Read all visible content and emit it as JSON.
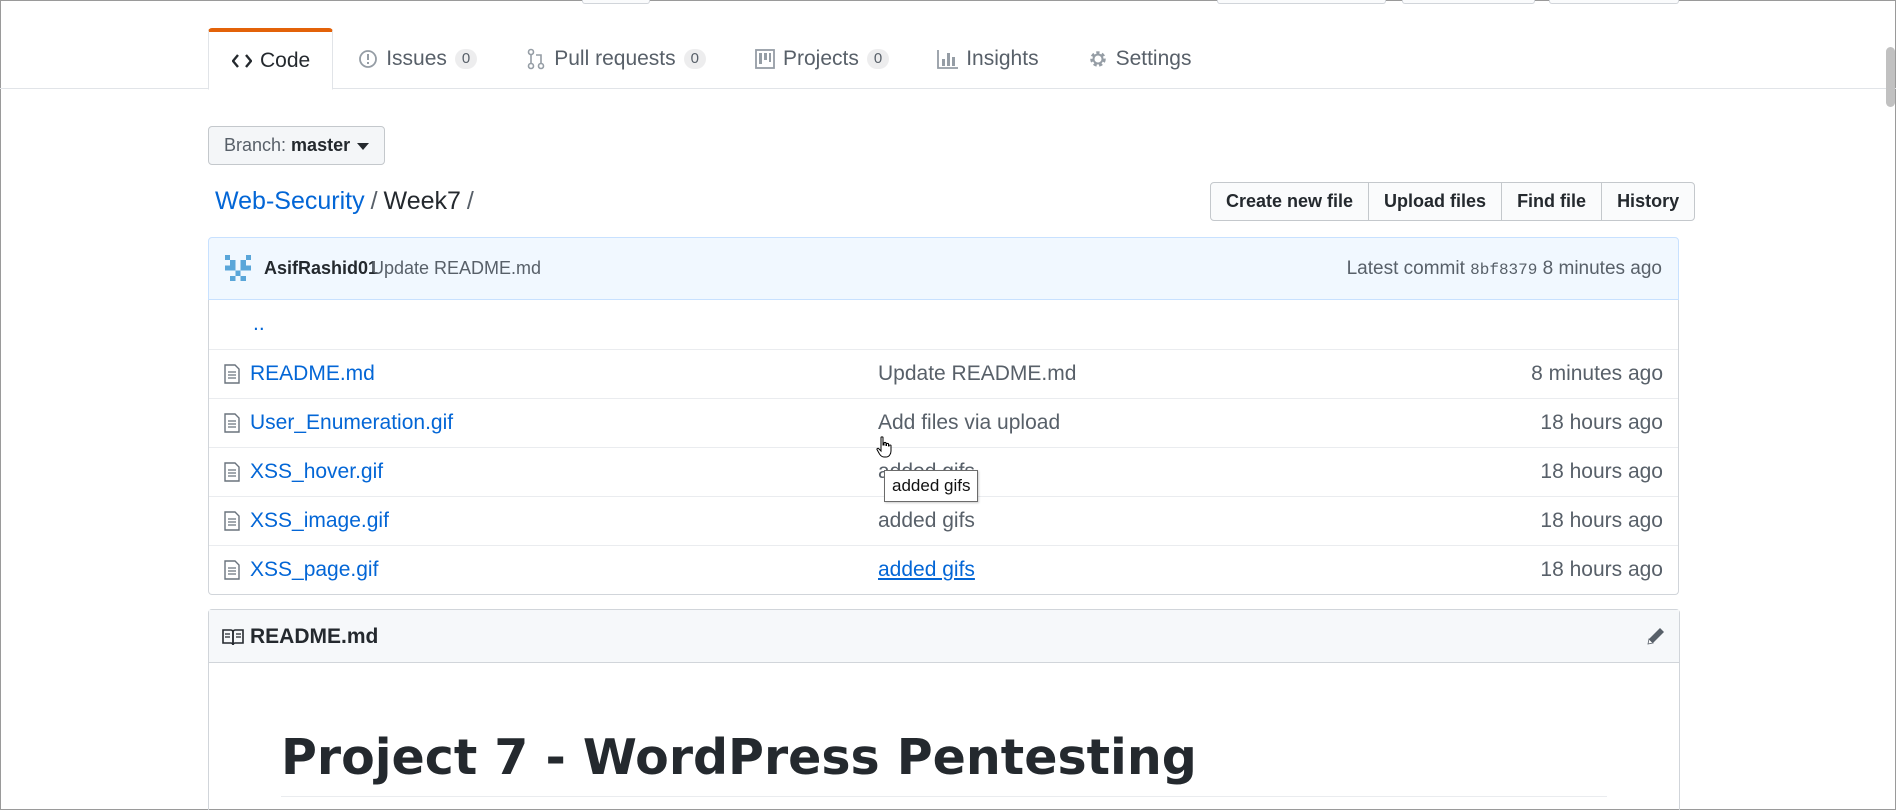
{
  "tabs": [
    {
      "label": "Code",
      "icon": "code-icon",
      "selected": true
    },
    {
      "label": "Issues",
      "icon": "issue-icon",
      "count": "0"
    },
    {
      "label": "Pull requests",
      "icon": "pull-request-icon",
      "count": "0"
    },
    {
      "label": "Projects",
      "icon": "project-icon",
      "count": "0"
    },
    {
      "label": "Insights",
      "icon": "graph-icon"
    },
    {
      "label": "Settings",
      "icon": "gear-icon"
    }
  ],
  "branch": {
    "prefix": "Branch:",
    "name": "master"
  },
  "breadcrumb": {
    "repo": "Web-Security",
    "folder": "Week7",
    "sep": "/"
  },
  "file_actions": [
    "Create new file",
    "Upload files",
    "Find file",
    "History"
  ],
  "commit": {
    "author": "AsifRashid01",
    "message": "Update README.md",
    "latest_label": "Latest commit",
    "sha": "8bf8379",
    "age": "8 minutes ago"
  },
  "parent_dir": "..",
  "files": [
    {
      "name": "README.md",
      "message": "Update README.md",
      "age": "8 minutes ago"
    },
    {
      "name": "User_Enumeration.gif",
      "message": "Add files via upload",
      "age": "18 hours ago"
    },
    {
      "name": "XSS_hover.gif",
      "message": "added gifs",
      "age": "18 hours ago"
    },
    {
      "name": "XSS_image.gif",
      "message": "added gifs",
      "age": "18 hours ago"
    },
    {
      "name": "XSS_page.gif",
      "message": "added gifs",
      "age": "18 hours ago"
    }
  ],
  "tooltip": "added gifs",
  "readme": {
    "filename": "README.md",
    "heading": "Project 7 - WordPress Pentesting"
  },
  "colors": {
    "link": "#0366d6",
    "tab_accent": "#e36209",
    "commit_bg": "#f1f8ff"
  }
}
